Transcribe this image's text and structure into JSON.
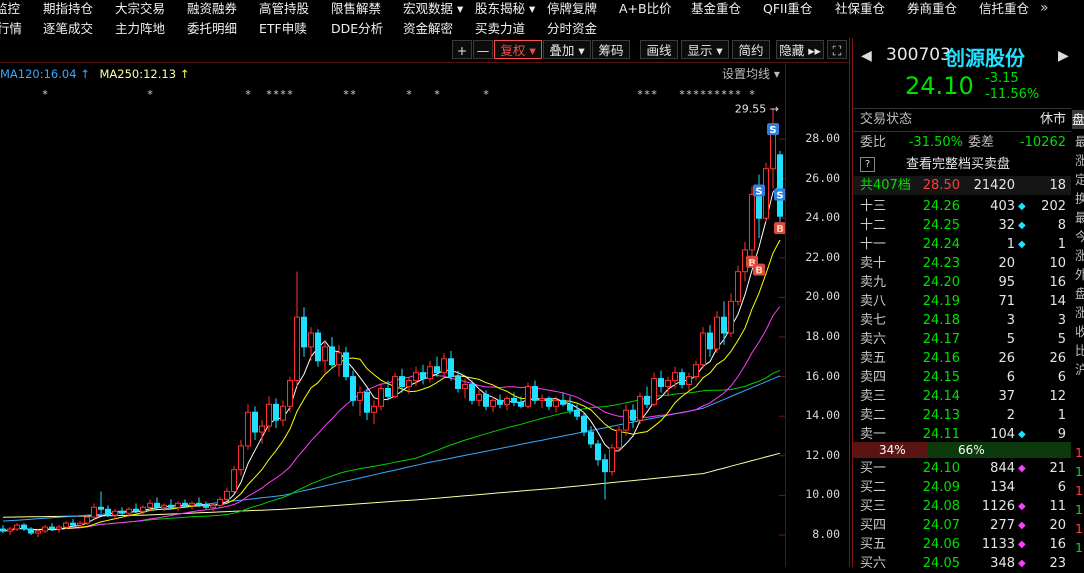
{
  "nav": {
    "row1": [
      "监控",
      "期指持仓",
      "大宗交易",
      "融资融券",
      "高管持股",
      "限售解禁",
      "宏观数据 ▾",
      "股东揭秘 ▾",
      "停牌复牌",
      "A+B比价",
      "基金重仓",
      "QFII重仓",
      "社保重仓",
      "券商重仓",
      "信托重仓"
    ],
    "more": "»",
    "row2": [
      "行情",
      "逐笔成交",
      "主力阵地",
      "委托明细",
      "ETF申赎",
      "DDE分析",
      "资金解密",
      "买卖力道",
      "分时资金"
    ]
  },
  "toolbar": {
    "plus": "+",
    "minus": "—",
    "fuquan": "复权 ▾",
    "diejia": "叠加 ▾",
    "chouma": "筹码",
    "huaxian": "画线",
    "xianshi": "显示 ▾",
    "jianyue": "简约",
    "yincang": "隐藏 ▸▸",
    "fullscreen": "⛶"
  },
  "legend": {
    "ma120": "MA120:16.04",
    "ma250": "MA250:12.13",
    "arrow": "↑",
    "settings": "设置均线 ▾"
  },
  "colors": {
    "up": "#ff3030",
    "down": "#1fe0ff",
    "ma5": "#ffffff",
    "ma10": "#ffff00",
    "ma20": "#ff3cff",
    "ma60": "#00d000",
    "ma120": "#3aa8ff",
    "ma250": "#ffffa8"
  },
  "kline": {
    "y_ticks": [
      28,
      26,
      24,
      22,
      20,
      18,
      16,
      14,
      12,
      10,
      8
    ],
    "y_tick_labels": [
      "28.00",
      "26.00",
      "24.00",
      "22.00",
      "20.00",
      "18.00",
      "16.00",
      "14.00",
      "12.00",
      "10.00",
      "8.00"
    ],
    "max_label": "29.55 →",
    "mark_symbol": "*",
    "marks_idx": [
      6,
      21,
      35,
      38,
      39,
      40,
      41,
      49,
      50,
      58,
      62,
      69,
      91,
      92,
      93,
      97,
      98,
      99,
      100,
      101,
      102,
      103,
      104,
      105,
      107
    ],
    "signals": [
      {
        "label": "S",
        "i": 110,
        "p": 28.5
      },
      {
        "label": "S",
        "i": 108,
        "p": 25.4
      },
      {
        "label": "S",
        "i": 111,
        "p": 25.2
      },
      {
        "label": "B",
        "i": 111,
        "p": 23.5
      },
      {
        "label": "B",
        "i": 107,
        "p": 21.8
      },
      {
        "label": "B",
        "i": 108,
        "p": 21.4
      }
    ],
    "ma120": {
      "idx": [
        0,
        20,
        40,
        60,
        80,
        100,
        111
      ],
      "val": [
        8.7,
        9.2,
        10.0,
        11.6,
        13.0,
        14.4,
        16.04
      ]
    },
    "ma250": {
      "idx": [
        0,
        20,
        40,
        60,
        80,
        100,
        111
      ],
      "val": [
        8.9,
        9.0,
        9.3,
        9.8,
        10.4,
        11.1,
        12.13
      ]
    },
    "candles": [
      [
        8.3,
        8.5,
        8.1,
        8.2
      ],
      [
        8.2,
        8.4,
        8.0,
        8.3
      ],
      [
        8.3,
        8.6,
        8.2,
        8.5
      ],
      [
        8.5,
        8.6,
        8.2,
        8.3
      ],
      [
        8.3,
        8.4,
        8.0,
        8.1
      ],
      [
        8.1,
        8.3,
        7.9,
        8.2
      ],
      [
        8.2,
        8.5,
        8.1,
        8.4
      ],
      [
        8.4,
        8.6,
        8.2,
        8.3
      ],
      [
        8.3,
        8.5,
        8.1,
        8.4
      ],
      [
        8.4,
        8.7,
        8.3,
        8.6
      ],
      [
        8.6,
        8.8,
        8.4,
        8.5
      ],
      [
        8.5,
        8.7,
        8.4,
        8.6
      ],
      [
        8.6,
        9.0,
        8.5,
        8.9
      ],
      [
        8.9,
        9.6,
        8.8,
        9.4
      ],
      [
        9.4,
        10.2,
        9.1,
        9.3
      ],
      [
        9.3,
        9.5,
        8.9,
        9.0
      ],
      [
        9.0,
        9.3,
        8.8,
        9.2
      ],
      [
        9.2,
        9.4,
        9.0,
        9.1
      ],
      [
        9.1,
        9.4,
        8.9,
        9.3
      ],
      [
        9.3,
        9.6,
        9.1,
        9.2
      ],
      [
        9.2,
        9.5,
        9.0,
        9.4
      ],
      [
        9.4,
        9.8,
        9.2,
        9.6
      ],
      [
        9.6,
        9.9,
        9.3,
        9.4
      ],
      [
        9.4,
        9.6,
        9.2,
        9.5
      ],
      [
        9.5,
        9.8,
        9.3,
        9.4
      ],
      [
        9.4,
        9.7,
        9.2,
        9.6
      ],
      [
        9.6,
        9.8,
        9.4,
        9.5
      ],
      [
        9.5,
        9.7,
        9.3,
        9.6
      ],
      [
        9.6,
        9.9,
        9.4,
        9.5
      ],
      [
        9.5,
        9.7,
        9.3,
        9.4
      ],
      [
        9.4,
        9.6,
        9.2,
        9.5
      ],
      [
        9.5,
        9.9,
        9.4,
        9.8
      ],
      [
        9.8,
        10.4,
        9.7,
        10.2
      ],
      [
        10.2,
        11.5,
        10.1,
        11.3
      ],
      [
        11.3,
        12.8,
        11.0,
        12.5
      ],
      [
        12.5,
        14.6,
        12.3,
        14.2
      ],
      [
        14.2,
        14.5,
        12.8,
        13.2
      ],
      [
        13.2,
        13.8,
        12.6,
        13.5
      ],
      [
        13.5,
        15.0,
        13.2,
        14.6
      ],
      [
        14.6,
        14.9,
        13.4,
        13.8
      ],
      [
        13.8,
        14.8,
        13.5,
        14.5
      ],
      [
        14.5,
        16.0,
        14.2,
        15.8
      ],
      [
        15.8,
        21.3,
        15.5,
        19.0
      ],
      [
        19.0,
        19.5,
        17.0,
        17.5
      ],
      [
        17.5,
        18.5,
        16.8,
        18.2
      ],
      [
        18.2,
        18.4,
        16.5,
        16.8
      ],
      [
        16.8,
        17.8,
        16.2,
        17.5
      ],
      [
        17.5,
        18.0,
        16.4,
        16.6
      ],
      [
        16.6,
        17.6,
        16.0,
        17.2
      ],
      [
        17.2,
        17.5,
        15.8,
        16.0
      ],
      [
        16.0,
        16.3,
        14.5,
        14.8
      ],
      [
        14.8,
        15.5,
        14.0,
        15.2
      ],
      [
        15.2,
        15.4,
        13.8,
        14.2
      ],
      [
        14.2,
        14.8,
        13.6,
        14.5
      ],
      [
        14.5,
        15.6,
        14.3,
        15.4
      ],
      [
        15.4,
        15.8,
        14.8,
        15.0
      ],
      [
        15.0,
        16.2,
        14.9,
        16.0
      ],
      [
        16.0,
        16.4,
        15.2,
        15.5
      ],
      [
        15.5,
        16.0,
        15.1,
        15.8
      ],
      [
        15.8,
        16.5,
        15.5,
        16.2
      ],
      [
        16.2,
        16.6,
        15.6,
        15.9
      ],
      [
        15.9,
        16.8,
        15.7,
        16.5
      ],
      [
        16.5,
        17.0,
        16.0,
        16.2
      ],
      [
        16.2,
        17.2,
        16.0,
        16.9
      ],
      [
        16.9,
        17.3,
        15.8,
        16.0
      ],
      [
        16.0,
        16.3,
        15.2,
        15.4
      ],
      [
        15.4,
        15.9,
        14.9,
        15.6
      ],
      [
        15.6,
        15.8,
        14.6,
        14.8
      ],
      [
        14.8,
        15.4,
        14.5,
        15.1
      ],
      [
        15.1,
        15.3,
        14.3,
        14.5
      ],
      [
        14.5,
        15.0,
        14.2,
        14.8
      ],
      [
        14.8,
        15.1,
        14.4,
        14.6
      ],
      [
        14.6,
        15.0,
        14.3,
        14.9
      ],
      [
        14.9,
        15.2,
        14.5,
        14.7
      ],
      [
        14.7,
        15.0,
        14.4,
        14.5
      ],
      [
        14.5,
        15.7,
        14.4,
        15.5
      ],
      [
        15.5,
        15.8,
        14.6,
        14.8
      ],
      [
        14.8,
        15.1,
        14.4,
        14.9
      ],
      [
        14.9,
        15.0,
        14.3,
        14.5
      ],
      [
        14.5,
        15.0,
        14.2,
        14.8
      ],
      [
        14.8,
        15.2,
        14.5,
        14.6
      ],
      [
        14.6,
        15.0,
        14.1,
        14.3
      ],
      [
        14.3,
        14.6,
        13.8,
        14.0
      ],
      [
        14.0,
        14.2,
        13.0,
        13.2
      ],
      [
        13.2,
        13.5,
        12.4,
        12.6
      ],
      [
        12.6,
        12.8,
        11.5,
        11.8
      ],
      [
        11.8,
        12.1,
        9.8,
        11.2
      ],
      [
        11.2,
        12.6,
        11.0,
        12.4
      ],
      [
        12.4,
        13.5,
        12.2,
        13.3
      ],
      [
        13.3,
        14.6,
        13.0,
        14.3
      ],
      [
        14.3,
        14.6,
        13.4,
        13.8
      ],
      [
        13.8,
        15.2,
        13.6,
        15.0
      ],
      [
        15.0,
        15.5,
        14.4,
        14.6
      ],
      [
        14.6,
        16.2,
        14.5,
        15.9
      ],
      [
        15.9,
        16.3,
        15.2,
        15.5
      ],
      [
        15.5,
        16.0,
        15.0,
        15.8
      ],
      [
        15.8,
        16.5,
        15.4,
        16.2
      ],
      [
        16.2,
        16.4,
        15.4,
        15.6
      ],
      [
        15.6,
        16.2,
        15.3,
        16.0
      ],
      [
        16.0,
        16.8,
        15.8,
        16.6
      ],
      [
        16.6,
        18.5,
        16.4,
        18.2
      ],
      [
        18.2,
        18.6,
        17.0,
        17.4
      ],
      [
        17.4,
        19.3,
        17.2,
        19.0
      ],
      [
        19.0,
        19.8,
        17.6,
        18.2
      ],
      [
        18.2,
        20.2,
        18.0,
        19.8
      ],
      [
        19.8,
        21.6,
        19.6,
        21.3
      ],
      [
        21.3,
        22.8,
        20.8,
        22.4
      ],
      [
        22.4,
        25.6,
        22.0,
        25.2
      ],
      [
        25.2,
        26.2,
        23.0,
        24.0
      ],
      [
        24.0,
        26.8,
        23.8,
        26.5
      ],
      [
        26.5,
        29.55,
        25.5,
        28.5
      ],
      [
        27.2,
        27.4,
        23.8,
        24.1
      ]
    ]
  },
  "quote": {
    "code": "300703",
    "name": "创源股份",
    "price": "24.10",
    "change": "-3.15",
    "pct": "-11.56%"
  },
  "status": {
    "label": "交易状态",
    "value": "休市"
  },
  "weibi": {
    "label": "委比",
    "value": "-31.50%",
    "diff_label": "委差",
    "diff_value": "-10262"
  },
  "full_book": {
    "help": "?",
    "label": "查看完整档买卖盘"
  },
  "summary": {
    "label": "共407档",
    "price": "28.50",
    "vol": "21420",
    "count": "18"
  },
  "asks": [
    {
      "label": "十三",
      "price": "24.26",
      "vol": "403",
      "flag": "◆",
      "flag_color": "cyan",
      "count": "202"
    },
    {
      "label": "十二",
      "price": "24.25",
      "vol": "32",
      "flag": "◆",
      "flag_color": "cyan",
      "count": "8"
    },
    {
      "label": "十一",
      "price": "24.24",
      "vol": "1",
      "flag": "◆",
      "flag_color": "cyan",
      "count": "1"
    },
    {
      "label": "卖十",
      "price": "24.23",
      "vol": "20",
      "flag": "",
      "flag_color": "",
      "count": "10"
    },
    {
      "label": "卖九",
      "price": "24.20",
      "vol": "95",
      "flag": "",
      "flag_color": "",
      "count": "16"
    },
    {
      "label": "卖八",
      "price": "24.19",
      "vol": "71",
      "flag": "",
      "flag_color": "",
      "count": "14"
    },
    {
      "label": "卖七",
      "price": "24.18",
      "vol": "3",
      "flag": "",
      "flag_color": "",
      "count": "3"
    },
    {
      "label": "卖六",
      "price": "24.17",
      "vol": "5",
      "flag": "",
      "flag_color": "",
      "count": "5"
    },
    {
      "label": "卖五",
      "price": "24.16",
      "vol": "26",
      "flag": "",
      "flag_color": "",
      "count": "26"
    },
    {
      "label": "卖四",
      "price": "24.15",
      "vol": "6",
      "flag": "",
      "flag_color": "",
      "count": "6"
    },
    {
      "label": "卖三",
      "price": "24.14",
      "vol": "37",
      "flag": "",
      "flag_color": "",
      "count": "12"
    },
    {
      "label": "卖二",
      "price": "24.13",
      "vol": "2",
      "flag": "",
      "flag_color": "",
      "count": "1"
    },
    {
      "label": "卖一",
      "price": "24.11",
      "vol": "104",
      "flag": "◆",
      "flag_color": "cyan",
      "count": "9"
    }
  ],
  "ratio": {
    "buy_pct": "34%",
    "sell_pct": "66%",
    "buy_share": 0.34
  },
  "bids": [
    {
      "label": "买一",
      "price": "24.10",
      "vol": "844",
      "flag": "◆",
      "flag_color": "mag",
      "count": "21"
    },
    {
      "label": "买二",
      "price": "24.09",
      "vol": "134",
      "flag": "",
      "flag_color": "",
      "count": "6"
    },
    {
      "label": "买三",
      "price": "24.08",
      "vol": "1126",
      "flag": "◆",
      "flag_color": "mag",
      "count": "11"
    },
    {
      "label": "买四",
      "price": "24.07",
      "vol": "277",
      "flag": "◆",
      "flag_color": "mag",
      "count": "20"
    },
    {
      "label": "买五",
      "price": "24.06",
      "vol": "1133",
      "flag": "◆",
      "flag_color": "mag",
      "count": "16"
    },
    {
      "label": "买六",
      "price": "24.05",
      "vol": "348",
      "flag": "◆",
      "flag_color": "mag",
      "count": "23"
    }
  ],
  "side_strip": {
    "tab": "盘",
    "chars": [
      "最",
      "涨",
      "定",
      "换",
      "最",
      "今",
      "涨",
      "外",
      "盘",
      "涨",
      "收",
      "比",
      "沪"
    ],
    "digits": [
      "1",
      "1",
      "1",
      "1",
      "1",
      "1"
    ]
  }
}
